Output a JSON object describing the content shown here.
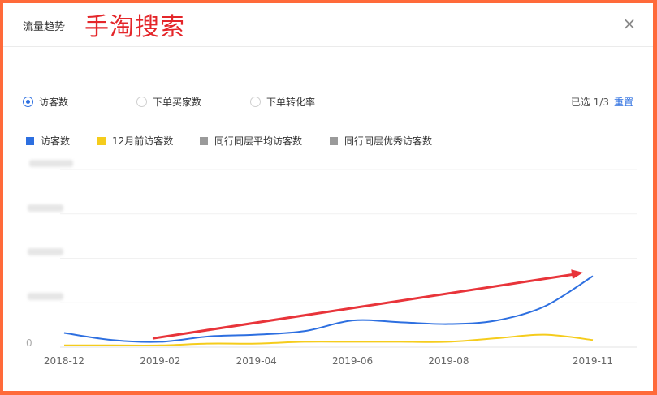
{
  "dialog": {
    "title": "流量趋势",
    "overlay_text": "手淘搜索",
    "close_icon": "×"
  },
  "metrics": {
    "options": [
      {
        "label": "访客数",
        "checked": true
      },
      {
        "label": "下单买家数",
        "checked": false
      },
      {
        "label": "下单转化率",
        "checked": false
      }
    ],
    "selected_count": "已选 1/3",
    "reset_label": "重置"
  },
  "legend": [
    {
      "label": "访客数",
      "color": "#2d6fe0"
    },
    {
      "label": "12月前访客数",
      "color": "#f5cc1c"
    },
    {
      "label": "同行同层平均访客数",
      "color": "#9a9a9a"
    },
    {
      "label": "同行同层优秀访客数",
      "color": "#9a9a9a"
    }
  ],
  "chart_data": {
    "type": "line",
    "x": [
      "2018-12",
      "2019-01",
      "2019-02",
      "2019-03",
      "2019-04",
      "2019-05",
      "2019-06",
      "2019-07",
      "2019-08",
      "2019-09",
      "2019-10",
      "2019-11"
    ],
    "xticks": [
      "2018-12",
      "2019-02",
      "2019-04",
      "2019-06",
      "2019-08",
      "2019-11"
    ],
    "y_tick_zero": "0",
    "ylim": [
      0,
      100
    ],
    "series": [
      {
        "name": "访客数",
        "color": "#2d6fe0",
        "values": [
          8,
          4,
          3,
          6,
          7,
          9,
          15,
          14,
          13,
          15,
          23,
          40
        ]
      },
      {
        "name": "12月前访客数",
        "color": "#f5cc1c",
        "values": [
          1,
          1,
          1,
          2,
          2,
          3,
          3,
          3,
          3,
          5,
          7,
          4
        ]
      }
    ],
    "annotation": {
      "type": "arrow",
      "color": "#e8343a"
    },
    "grid": true
  }
}
